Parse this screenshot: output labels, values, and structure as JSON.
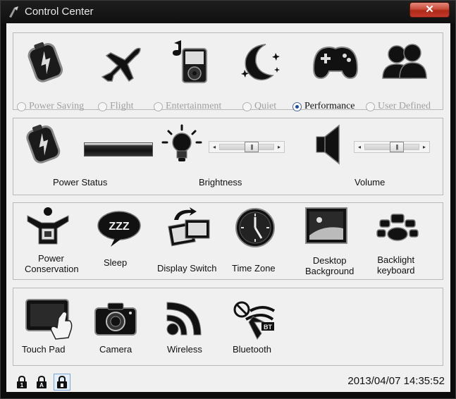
{
  "window": {
    "title": "Control Center",
    "close_label": "✕"
  },
  "modes": {
    "items": [
      {
        "label": "Power Saving",
        "selected": false
      },
      {
        "label": "Flight",
        "selected": false
      },
      {
        "label": "Entertainment",
        "selected": false
      },
      {
        "label": "Quiet",
        "selected": false
      },
      {
        "label": "Performance",
        "selected": true
      },
      {
        "label": "User Defined",
        "selected": false
      }
    ],
    "icons": [
      "battery-icon",
      "airplane-icon",
      "music-player-icon",
      "moon-stars-icon",
      "gamepad-icon",
      "users-icon"
    ]
  },
  "status": {
    "power_label": "Power Status",
    "brightness_label": "Brightness",
    "volume_label": "Volume",
    "brightness_level": 0.62,
    "volume_level": 0.62
  },
  "tools": {
    "items": [
      {
        "label_line1": "Power",
        "label_line2": "Conservation",
        "icon": "power-conservation-icon"
      },
      {
        "label_line1": "Sleep",
        "label_line2": "",
        "icon": "sleep-icon"
      },
      {
        "label_line1": "Display Switch",
        "label_line2": "",
        "icon": "display-switch-icon"
      },
      {
        "label_line1": "Time Zone",
        "label_line2": "",
        "icon": "clock-icon"
      },
      {
        "label_line1": "Desktop",
        "label_line2": "Background",
        "icon": "desktop-background-icon"
      },
      {
        "label_line1": "Backlight",
        "label_line2": "keyboard",
        "icon": "backlight-keyboard-icon"
      }
    ]
  },
  "devices": {
    "items": [
      {
        "label": "Touch Pad",
        "icon": "touchpad-icon"
      },
      {
        "label": "Camera",
        "icon": "camera-icon"
      },
      {
        "label": "Wireless",
        "icon": "wireless-icon"
      },
      {
        "label": "Bluetooth",
        "icon": "bluetooth-icon"
      }
    ]
  },
  "statusbar": {
    "locks": [
      "num-lock-icon",
      "caps-lock-icon",
      "scroll-lock-icon"
    ],
    "lock_letters": [
      "1",
      "A",
      ""
    ],
    "datetime": "2013/04/07 14:35:52"
  }
}
